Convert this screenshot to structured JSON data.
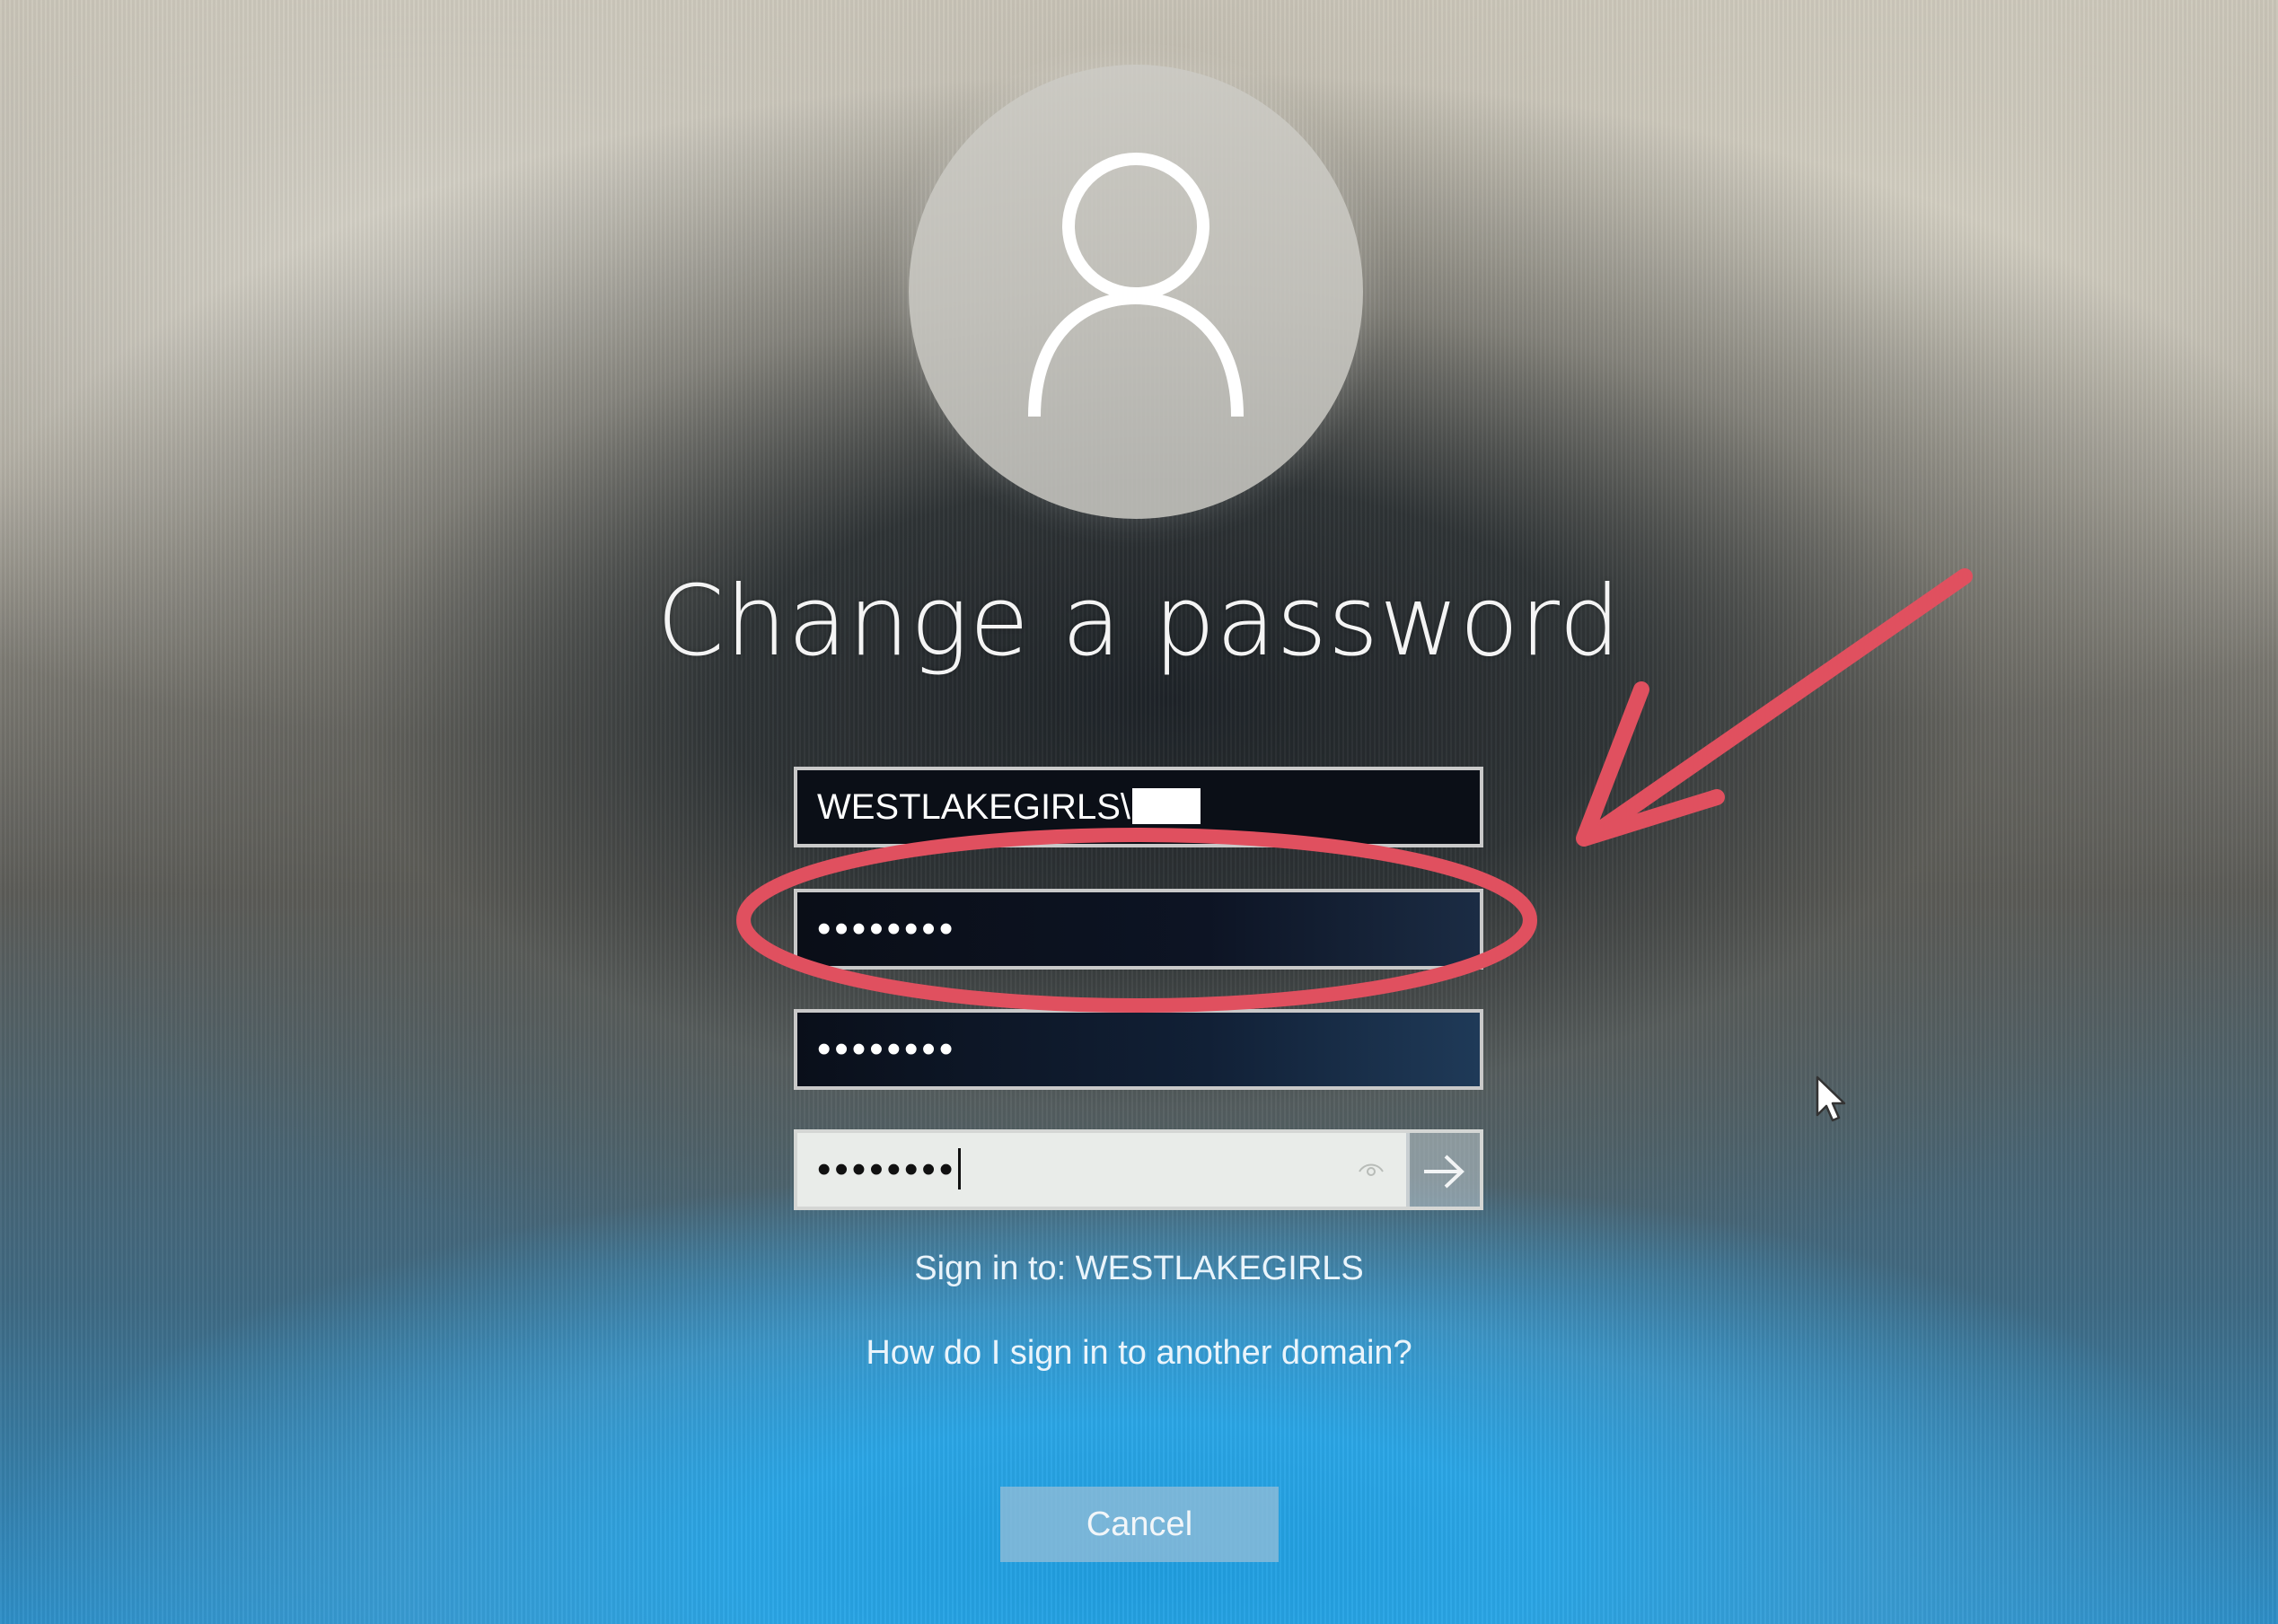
{
  "screen": {
    "title": "Change a password"
  },
  "fields": {
    "username_value": "WESTLAKEGIRLS\\",
    "old_password_mask": "••••••••",
    "new_password_mask": "••••••••",
    "confirm_password_mask": "••••••••"
  },
  "links": {
    "sign_in_to": "Sign in to: WESTLAKEGIRLS",
    "other_domain": "How do I sign in to another domain?"
  },
  "buttons": {
    "cancel_label": "Cancel"
  },
  "icons": {
    "avatar": "user-icon",
    "reveal": "eye-icon",
    "submit": "arrow-right-icon",
    "cursor": "mouse-pointer-icon"
  },
  "annotation_color": "#e0505f"
}
